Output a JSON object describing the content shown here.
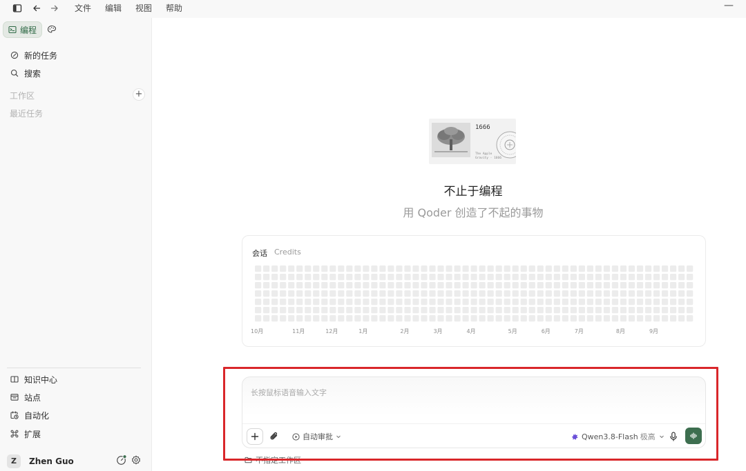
{
  "topbar": {
    "menus": [
      {
        "label": "文件"
      },
      {
        "label": "编辑"
      },
      {
        "label": "视图"
      },
      {
        "label": "帮助"
      }
    ],
    "minimize_symbol": "—",
    "icons": [
      "sidebar-toggle-icon",
      "back-arrow-icon",
      "forward-arrow-icon",
      "minimize-icon"
    ]
  },
  "sidebar": {
    "tabs": {
      "code_label": "编程",
      "paint_icon": "palette-icon"
    },
    "nav": [
      {
        "label": "新的任务",
        "icon": "new-task-icon"
      },
      {
        "label": "搜索",
        "icon": "search-icon"
      }
    ],
    "workspace_label": "工作区",
    "add_symbol": "+",
    "recent_label": "最近任务",
    "bottom": [
      {
        "label": "知识中心",
        "icon": "book-icon"
      },
      {
        "label": "站点",
        "icon": "site-icon"
      },
      {
        "label": "自动化",
        "icon": "automation-icon"
      },
      {
        "label": "扩展",
        "icon": "extension-icon"
      }
    ],
    "user": {
      "initial": "Z",
      "name": "Zhen Guo"
    }
  },
  "main": {
    "hero_card": {
      "year": "1666",
      "caption_line1": "The Apple",
      "caption_line2": "Gravity · 1666"
    },
    "title": "不止于编程",
    "subtitle": "用 Qoder 创造了不起的事物",
    "activity": {
      "tabs": [
        "会话",
        "Credits"
      ],
      "weeks": 53,
      "days": 7,
      "months": [
        {
          "label": "10月",
          "week": 1
        },
        {
          "label": "11月",
          "week": 6
        },
        {
          "label": "12月",
          "week": 10
        },
        {
          "label": "1月",
          "week": 14
        },
        {
          "label": "2月",
          "week": 19
        },
        {
          "label": "3月",
          "week": 23
        },
        {
          "label": "4月",
          "week": 27
        },
        {
          "label": "5月",
          "week": 32
        },
        {
          "label": "6月",
          "week": 36
        },
        {
          "label": "7月",
          "week": 40
        },
        {
          "label": "8月",
          "week": 45
        },
        {
          "label": "9月",
          "week": 49
        }
      ]
    },
    "composer": {
      "placeholder": "长按鼠标语音输入文字",
      "auto_approve": "自动审批",
      "model": "Qwen3.8-Flash",
      "effort": "极高"
    },
    "workspace_hint": "不指定工作区"
  },
  "colors": {
    "accent_green": "#3d6e4f",
    "highlight_red": "#d9262a",
    "grid_cell": "#ececec"
  }
}
